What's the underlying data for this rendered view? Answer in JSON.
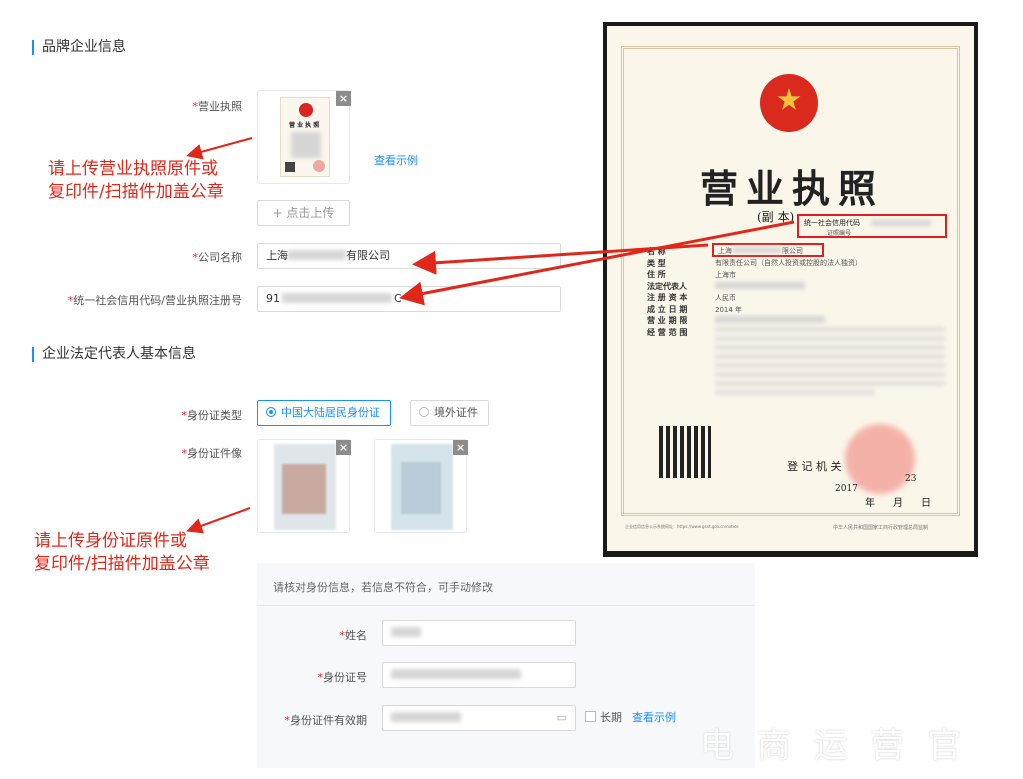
{
  "brand_section": {
    "title": "品牌企业信息",
    "license_label": "营业执照",
    "view_example": "查看示例",
    "upload_button": "+ 点击上传",
    "company_name_label": "公司名称",
    "company_name_prefix": "上海",
    "company_name_suffix": "有限公司",
    "credit_code_label": "统一社会信用代码/营业执照注册号",
    "credit_code_prefix": "91",
    "credit_code_suffix": "C",
    "note": [
      "请上传营业执照原件或",
      "复印件/扫描件加盖公章"
    ]
  },
  "legal_section": {
    "title": "企业法定代表人基本信息",
    "id_type_label": "身份证类型",
    "id_type_options": [
      "中国大陆居民身份证",
      "境外证件"
    ],
    "id_photo_label": "身份证件像",
    "note": [
      "请上传身份证原件或",
      "复印件/扫描件加盖公章"
    ],
    "verify_hint": "请核对身份信息，若信息不符合，可手动修改",
    "name_label": "姓名",
    "id_number_label": "身份证号",
    "validity_label": "身份证件有效期",
    "long_term_label": "长期",
    "view_example": "查看示例"
  },
  "license_image": {
    "title": "营业执照",
    "subtitle": "(副 本)",
    "credit_code_caption": "统一社会信用代码",
    "cert_no_caption": "证照编号",
    "fields": [
      "名 称",
      "类 型",
      "住 所",
      "法定代表人",
      "注 册 资 本",
      "成 立 日 期",
      "营 业 期 限",
      "经 营 范 围"
    ],
    "type_value": "有限责任公司（自然人投资或控股的法人独资）",
    "name_value_prefix": "上海",
    "name_value_suffix": "限公司",
    "address_prefix": "上海市",
    "capital_prefix": "人民币",
    "date_prefix": "2014 年",
    "registrar": "登 记 机 关",
    "year": "2017",
    "day": "23",
    "year_char": "年",
    "month_char": "月",
    "day_char": "日",
    "footer_left": "企业信用信息公示系统网址：https://www.gsxt.gov.cn/notice",
    "footer_right": "中华人民共和国国家工商行政管理总局监制"
  },
  "watermark": "电 商 运 营 官",
  "colors": {
    "accent": "#1890ff",
    "required": "#f5222d",
    "annotation": "#e0271a"
  }
}
